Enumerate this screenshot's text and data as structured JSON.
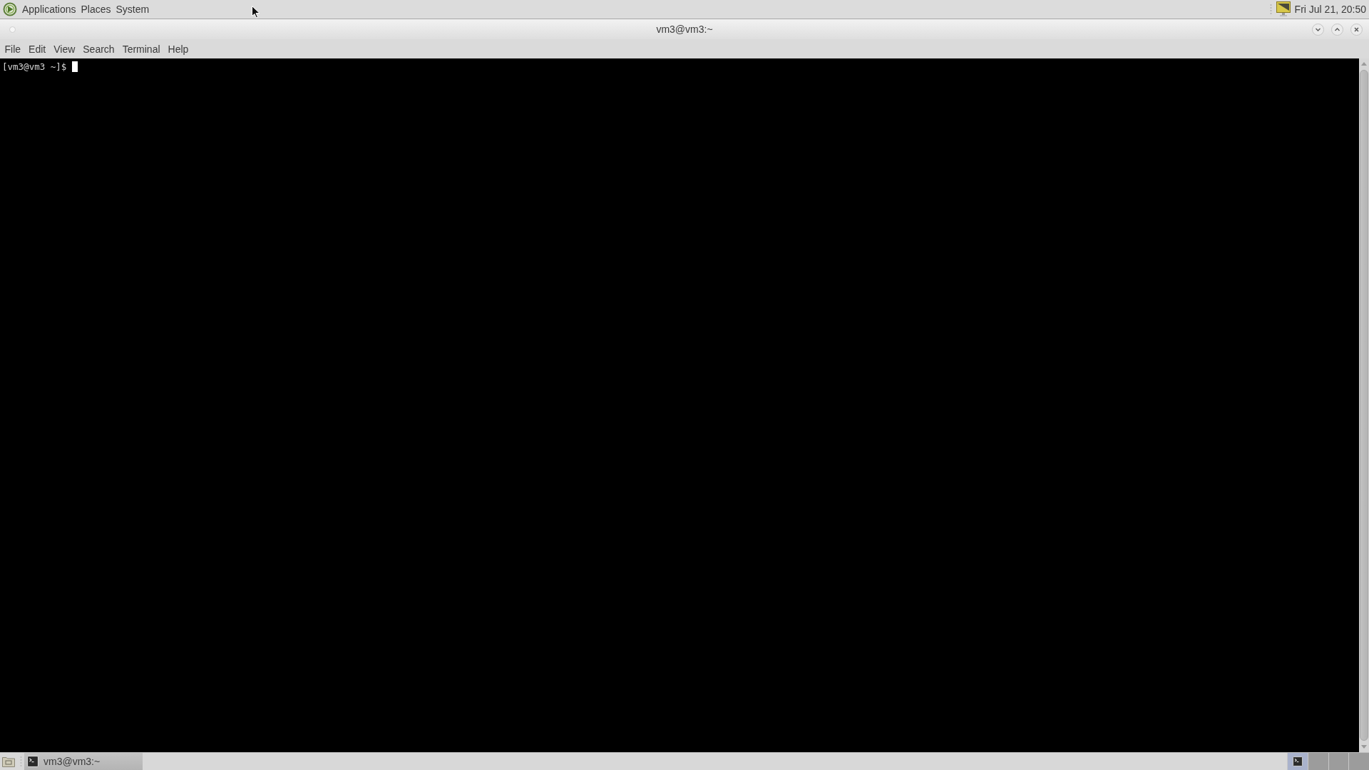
{
  "top_panel": {
    "menus": [
      "Applications",
      "Places",
      "System"
    ],
    "clock": "Fri Jul 21, 20:50"
  },
  "window": {
    "title": "vm3@vm3:~",
    "menu": [
      "File",
      "Edit",
      "View",
      "Search",
      "Terminal",
      "Help"
    ]
  },
  "terminal": {
    "prompt": "[vm3@vm3 ~]$"
  },
  "bottom_panel": {
    "tasks": [
      {
        "label": "vm3@vm3:~",
        "selected": true
      }
    ],
    "workspaces": [
      {
        "selected": true,
        "has_window": true
      },
      {
        "selected": false,
        "has_window": false
      },
      {
        "selected": false,
        "has_window": false
      },
      {
        "selected": false,
        "has_window": false
      }
    ]
  }
}
